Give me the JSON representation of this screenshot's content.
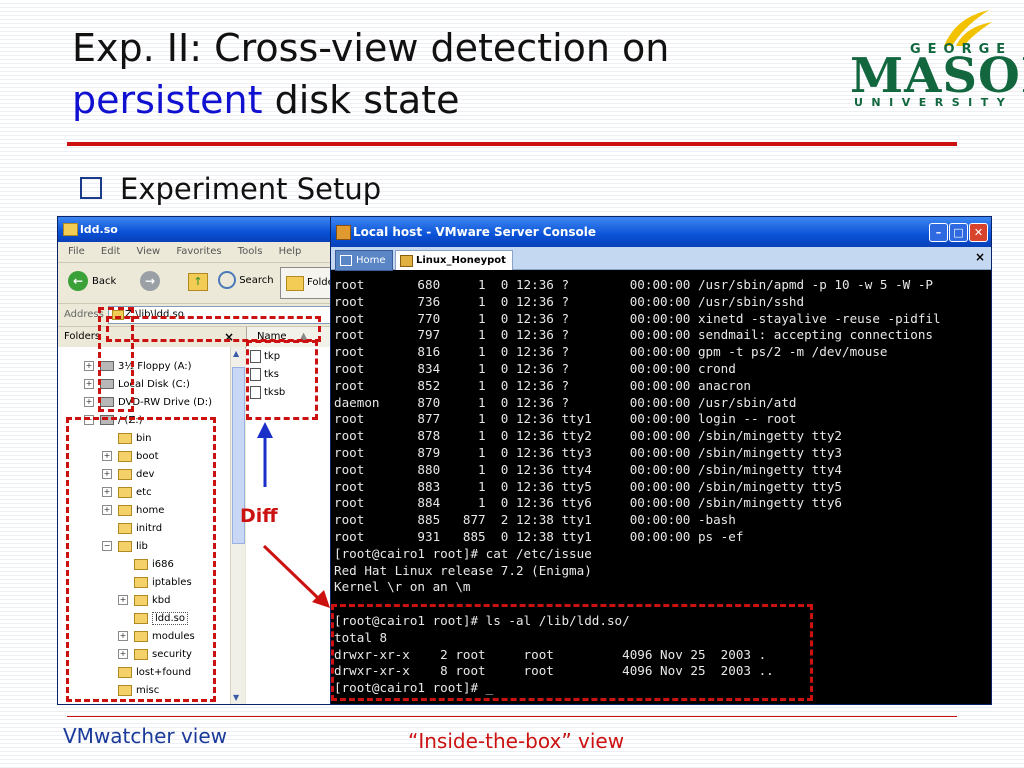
{
  "slide": {
    "title_part1": "Exp. II: Cross-view detection on",
    "title_highlight": "persistent",
    "title_part2": " disk state",
    "bullet": "Experiment Setup",
    "diff_label": "Diff",
    "caption_left": "VMwatcher view",
    "caption_right": "“Inside-the-box” view",
    "colors": {
      "title_highlight": "#1010d0",
      "rule": "#cc1111",
      "caption_left": "#1a3a9a",
      "caption_right": "#cc1111",
      "logo_green": "#12673f"
    }
  },
  "logo": {
    "top": "GEORGE",
    "main": "MASON",
    "bottom": "UNIVERSITY"
  },
  "explorer": {
    "title": "ldd.so",
    "menu": [
      "File",
      "Edit",
      "View",
      "Favorites",
      "Tools",
      "Help"
    ],
    "back_label": "Back",
    "search_label": "Search",
    "folders_button": "Folders",
    "address_label": "Address",
    "address_value": "Z:\\lib\\ldd.so",
    "pane_title": "Folders",
    "pane_close": "×",
    "name_column": "Name",
    "tree": [
      {
        "label": "3½ Floppy (A:)",
        "kind": "drive"
      },
      {
        "label": "Local Disk (C:)",
        "kind": "drive"
      },
      {
        "label": "DVD-RW Drive (D:)",
        "kind": "drive"
      },
      {
        "label": "/ (Z:)",
        "kind": "drive"
      },
      {
        "label": "bin"
      },
      {
        "label": "boot"
      },
      {
        "label": "dev"
      },
      {
        "label": "etc"
      },
      {
        "label": "home"
      },
      {
        "label": "initrd"
      },
      {
        "label": "lib"
      },
      {
        "label": "i686"
      },
      {
        "label": "iptables"
      },
      {
        "label": "kbd"
      },
      {
        "label": "ldd.so"
      },
      {
        "label": "modules"
      },
      {
        "label": "security"
      },
      {
        "label": "lost+found"
      },
      {
        "label": "misc"
      }
    ],
    "files": [
      "tkp",
      "tks",
      "tksb"
    ]
  },
  "console": {
    "title": "Local host - VMware Server Console",
    "tab_home": "Home",
    "tab_vm": "Linux_Honeypot",
    "tab_close": "×",
    "lines": [
      "root       680     1  0 12:36 ?        00:00:00 /usr/sbin/apmd -p 10 -w 5 -W -P",
      "root       736     1  0 12:36 ?        00:00:00 /usr/sbin/sshd",
      "root       770     1  0 12:36 ?        00:00:00 xinetd -stayalive -reuse -pidfil",
      "root       797     1  0 12:36 ?        00:00:00 sendmail: accepting connections",
      "root       816     1  0 12:36 ?        00:00:00 gpm -t ps/2 -m /dev/mouse",
      "root       834     1  0 12:36 ?        00:00:00 crond",
      "root       852     1  0 12:36 ?        00:00:00 anacron",
      "daemon     870     1  0 12:36 ?        00:00:00 /usr/sbin/atd",
      "root       877     1  0 12:36 tty1     00:00:00 login -- root",
      "root       878     1  0 12:36 tty2     00:00:00 /sbin/mingetty tty2",
      "root       879     1  0 12:36 tty3     00:00:00 /sbin/mingetty tty3",
      "root       880     1  0 12:36 tty4     00:00:00 /sbin/mingetty tty4",
      "root       883     1  0 12:36 tty5     00:00:00 /sbin/mingetty tty5",
      "root       884     1  0 12:36 tty6     00:00:00 /sbin/mingetty tty6",
      "root       885   877  2 12:38 tty1     00:00:00 -bash",
      "root       931   885  0 12:38 tty1     00:00:00 ps -ef",
      "[root@cairo1 root]# cat /etc/issue",
      "Red Hat Linux release 7.2 (Enigma)",
      "Kernel \\r on an \\m",
      "",
      "[root@cairo1 root]# ls -al /lib/ldd.so/",
      "total 8",
      "drwxr-xr-x    2 root     root         4096 Nov 25  2003 .",
      "drwxr-xr-x    8 root     root         4096 Nov 25  2003 ..",
      "[root@cairo1 root]# _"
    ]
  }
}
